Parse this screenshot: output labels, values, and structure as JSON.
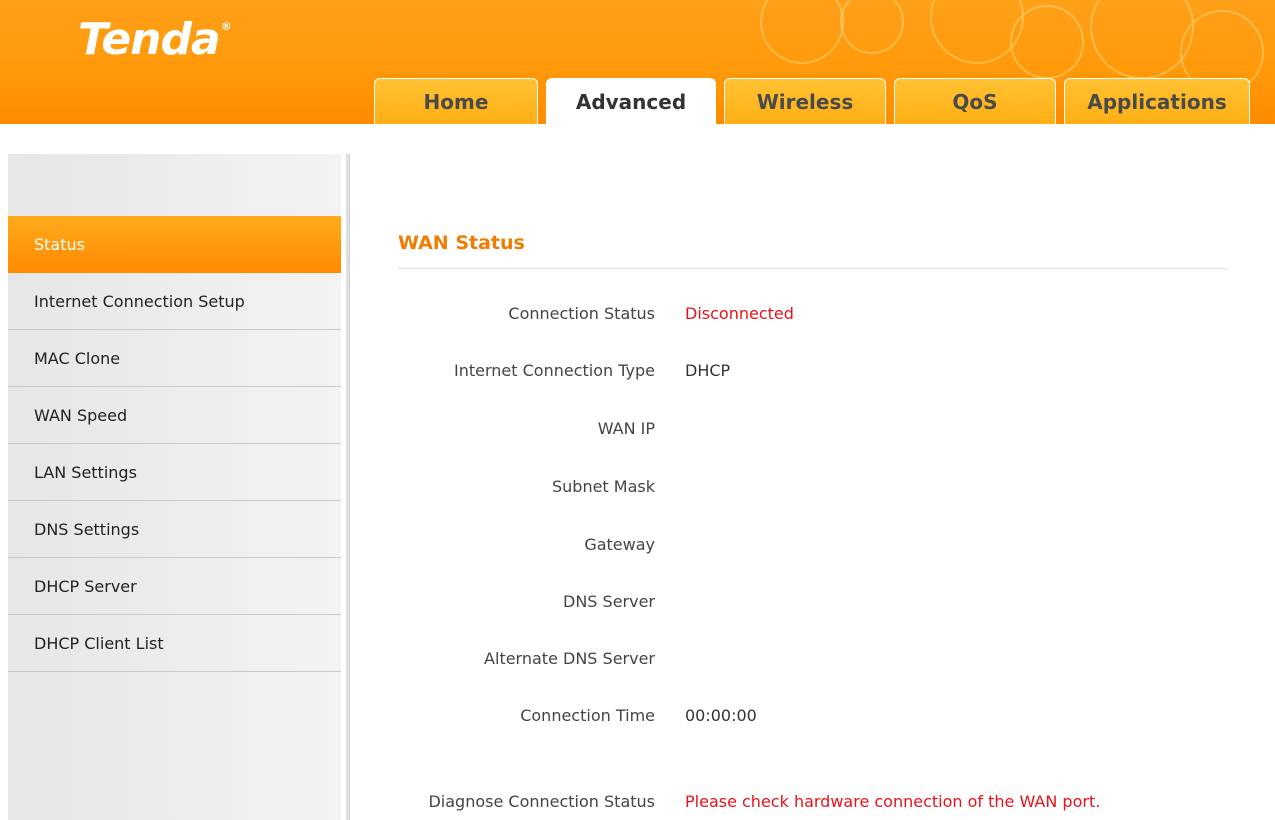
{
  "brand": {
    "logo_text": "Tenda"
  },
  "tabs": [
    {
      "label": "Home"
    },
    {
      "label": "Advanced"
    },
    {
      "label": "Wireless"
    },
    {
      "label": "QoS"
    },
    {
      "label": "Applications"
    }
  ],
  "active_tab": "Advanced",
  "sidebar": {
    "items": [
      {
        "label": "Status"
      },
      {
        "label": "Internet Connection Setup"
      },
      {
        "label": "MAC Clone"
      },
      {
        "label": "WAN Speed"
      },
      {
        "label": "LAN Settings"
      },
      {
        "label": "DNS Settings"
      },
      {
        "label": "DHCP Server"
      },
      {
        "label": "DHCP Client List"
      }
    ],
    "active_item": "Status"
  },
  "wan_status": {
    "title": "WAN Status",
    "rows": [
      {
        "label": "Connection Status",
        "value": "Disconnected"
      },
      {
        "label": "Internet Connection Type",
        "value": "DHCP"
      },
      {
        "label": "WAN IP",
        "value": ""
      },
      {
        "label": "Subnet Mask",
        "value": ""
      },
      {
        "label": "Gateway",
        "value": ""
      },
      {
        "label": "DNS Server",
        "value": ""
      },
      {
        "label": "Alternate DNS Server",
        "value": ""
      },
      {
        "label": "Connection Time",
        "value": "00:00:00"
      },
      {
        "label": "Diagnose Connection Status",
        "value": "Please check hardware connection of the WAN port."
      }
    ]
  },
  "colors": {
    "brand_orange": "#ff9a0a",
    "title_orange": "#f07d00",
    "alert_red": "#e8121b"
  }
}
